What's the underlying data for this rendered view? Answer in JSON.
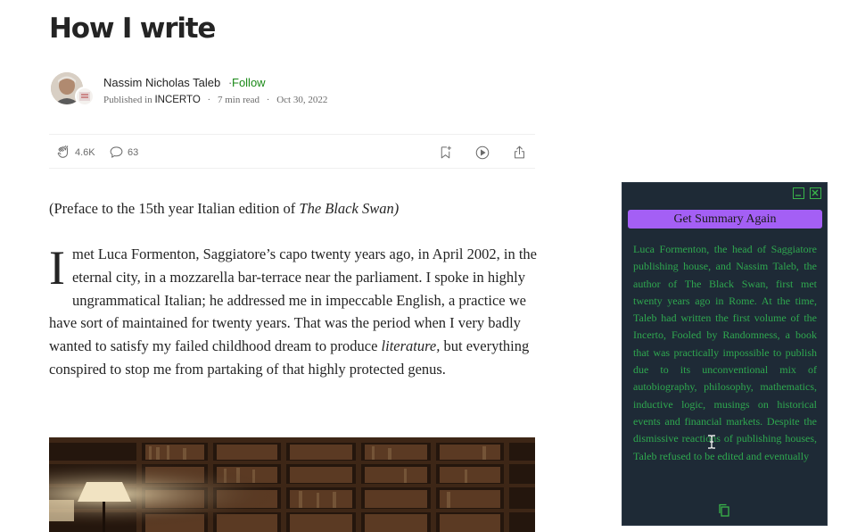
{
  "article": {
    "title": "How I write",
    "author": "Nassim Nicholas Taleb",
    "dot": "·",
    "follow_label": "Follow",
    "published_in_label": "Published in",
    "publication": "INCERTO",
    "read_time": "7 min read",
    "date": "Oct 30, 2022",
    "separator": "·",
    "claps": "4.6K",
    "responses": "63",
    "preface_prefix": "(Preface to the 15th year Italian edition of ",
    "preface_book": "The Black Swan)",
    "dropcap": "I",
    "para_part1": " met Luca Formenton, Saggiatore’s capo twenty years ago, in April 2002, in the eternal city, in a mozzarella bar-terrace near the parliament. I spoke in highly ungrammatical Italian; he addressed me in impeccable English, a practice we have sort of maintained for twenty years. That was the period when I very badly wanted to satisfy my failed childhood dream to produce ",
    "para_em": "literature,",
    "para_part2": " but everything conspired to stop me from partaking of that highly protected genus."
  },
  "summary_panel": {
    "button_label": "Get Summary Again",
    "text": "Luca Formenton, the head of Saggiatore publishing house, and Nassim Taleb, the author of The Black Swan, first met twenty years ago in Rome. At the time, Taleb had written the first volume of the Incerto, Fooled by Randomness, a book that was practically impossible to publish due to its unconventional mix of autobiography, philosophy, mathematics, inductive logic, musings on historical events and financial markets. Despite the dismissive reactions of publishing houses, Taleb refused to be edited and eventually",
    "accent_color": "#2fa84f",
    "button_color": "#a45ff5",
    "background_color": "#1e2a36"
  },
  "icons": {
    "clap": "clap-icon",
    "response": "speech-bubble-icon",
    "bookmark": "bookmark-add-icon",
    "listen": "play-icon",
    "share": "share-icon",
    "minimize": "minimize-icon",
    "close": "close-icon",
    "copy": "copy-icon",
    "cursor": "text-cursor-icon"
  }
}
